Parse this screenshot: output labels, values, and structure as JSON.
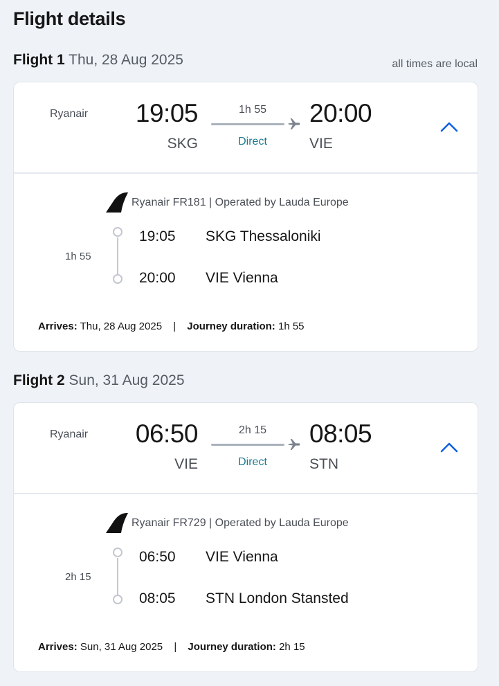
{
  "page": {
    "title": "Flight details",
    "local_note": "all times are local"
  },
  "flights": [
    {
      "label": "Flight 1",
      "date": "Thu, 28 Aug 2025",
      "airline": "Ryanair",
      "dep_time": "19:05",
      "arr_time": "20:00",
      "dep_code": "SKG",
      "arr_code": "VIE",
      "duration": "1h 55",
      "stops": "Direct",
      "carrier": "Ryanair FR181 | Operated by Lauda Europe",
      "seg_duration": "1h 55",
      "seg_dep_time": "19:05",
      "seg_dep_place": "SKG Thessaloniki",
      "seg_arr_time": "20:00",
      "seg_arr_place": "VIE Vienna",
      "arrives_label": "Arrives:",
      "arrives_value": "Thu, 28 Aug 2025",
      "separator": "|",
      "journey_label": "Journey duration:",
      "journey_value": "1h 55"
    },
    {
      "label": "Flight 2",
      "date": "Sun, 31 Aug 2025",
      "airline": "Ryanair",
      "dep_time": "06:50",
      "arr_time": "08:05",
      "dep_code": "VIE",
      "arr_code": "STN",
      "duration": "2h 15",
      "stops": "Direct",
      "carrier": "Ryanair FR729 | Operated by Lauda Europe",
      "seg_duration": "2h 15",
      "seg_dep_time": "06:50",
      "seg_dep_place": "VIE Vienna",
      "seg_arr_time": "08:05",
      "seg_arr_place": "STN London Stansted",
      "arrives_label": "Arrives:",
      "arrives_value": "Sun, 31 Aug 2025",
      "separator": "|",
      "journey_label": "Journey duration:",
      "journey_value": "2h 15"
    }
  ],
  "icons": {
    "plane": "plane-icon",
    "tail": "airline-tail-logo",
    "collapse": "chevron-up-icon"
  },
  "colors": {
    "accent": "#1060e0",
    "direct": "#1b7a8f",
    "background": "#eff3f8"
  }
}
